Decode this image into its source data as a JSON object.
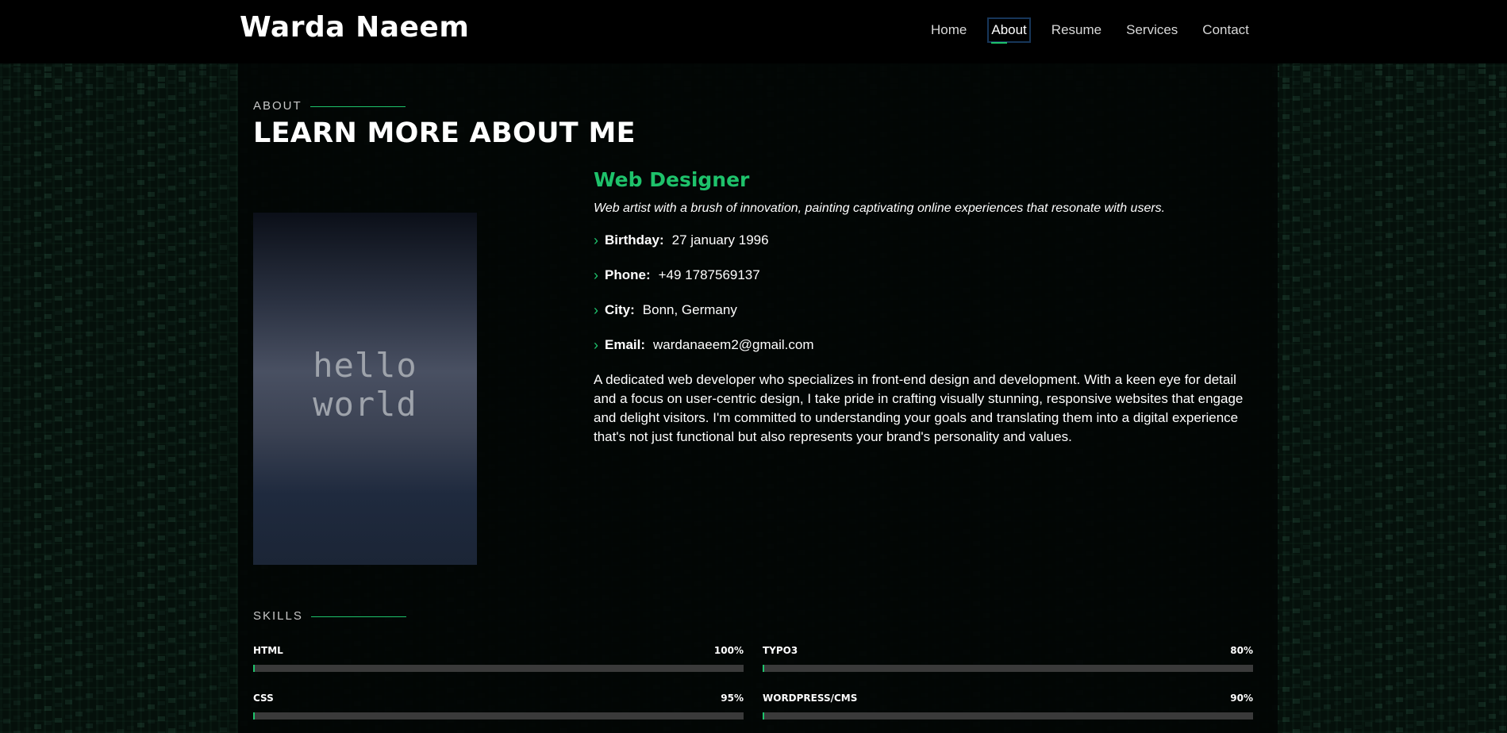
{
  "header": {
    "logo": "Warda Naeem",
    "nav": [
      {
        "label": "Home",
        "active": false
      },
      {
        "label": "About",
        "active": true
      },
      {
        "label": "Resume",
        "active": false
      },
      {
        "label": "Services",
        "active": false
      },
      {
        "label": "Contact",
        "active": false
      }
    ]
  },
  "about": {
    "section_label": "ABOUT",
    "title": "LEARN MORE ABOUT ME",
    "photo_text": "hello world",
    "role": "Web Designer",
    "tagline": "Web artist with a brush of innovation, painting captivating online experiences that resonate with users.",
    "info": [
      {
        "key": "Birthday:",
        "value": "27 january 1996"
      },
      {
        "key": "Phone:",
        "value": "+49 1787569137"
      },
      {
        "key": "City:",
        "value": "Bonn, Germany"
      },
      {
        "key": "Email:",
        "value": "wardanaeem2@gmail.com"
      }
    ],
    "bio": "A dedicated web developer who specializes in front-end design and development. With a keen eye for detail and a focus on user-centric design, I take pride in crafting visually stunning, responsive websites that engage and delight visitors. I'm committed to understanding your goals and translating them into a digital experience that's not just functional but also represents your brand's personality and values."
  },
  "skills": {
    "section_label": "SKILLS",
    "items": [
      {
        "name": "HTML",
        "percent_label": "100%",
        "progress": 0.0
      },
      {
        "name": "TYPO3",
        "percent_label": "80%",
        "progress": 0.0
      },
      {
        "name": "CSS",
        "percent_label": "95%",
        "progress": 0.0
      },
      {
        "name": "WORDPRESS/CMS",
        "percent_label": "90%",
        "progress": 0.0
      }
    ]
  },
  "colors": {
    "accent": "#1ec26b",
    "background": "#020403",
    "bar_track": "#3a3a3a"
  }
}
